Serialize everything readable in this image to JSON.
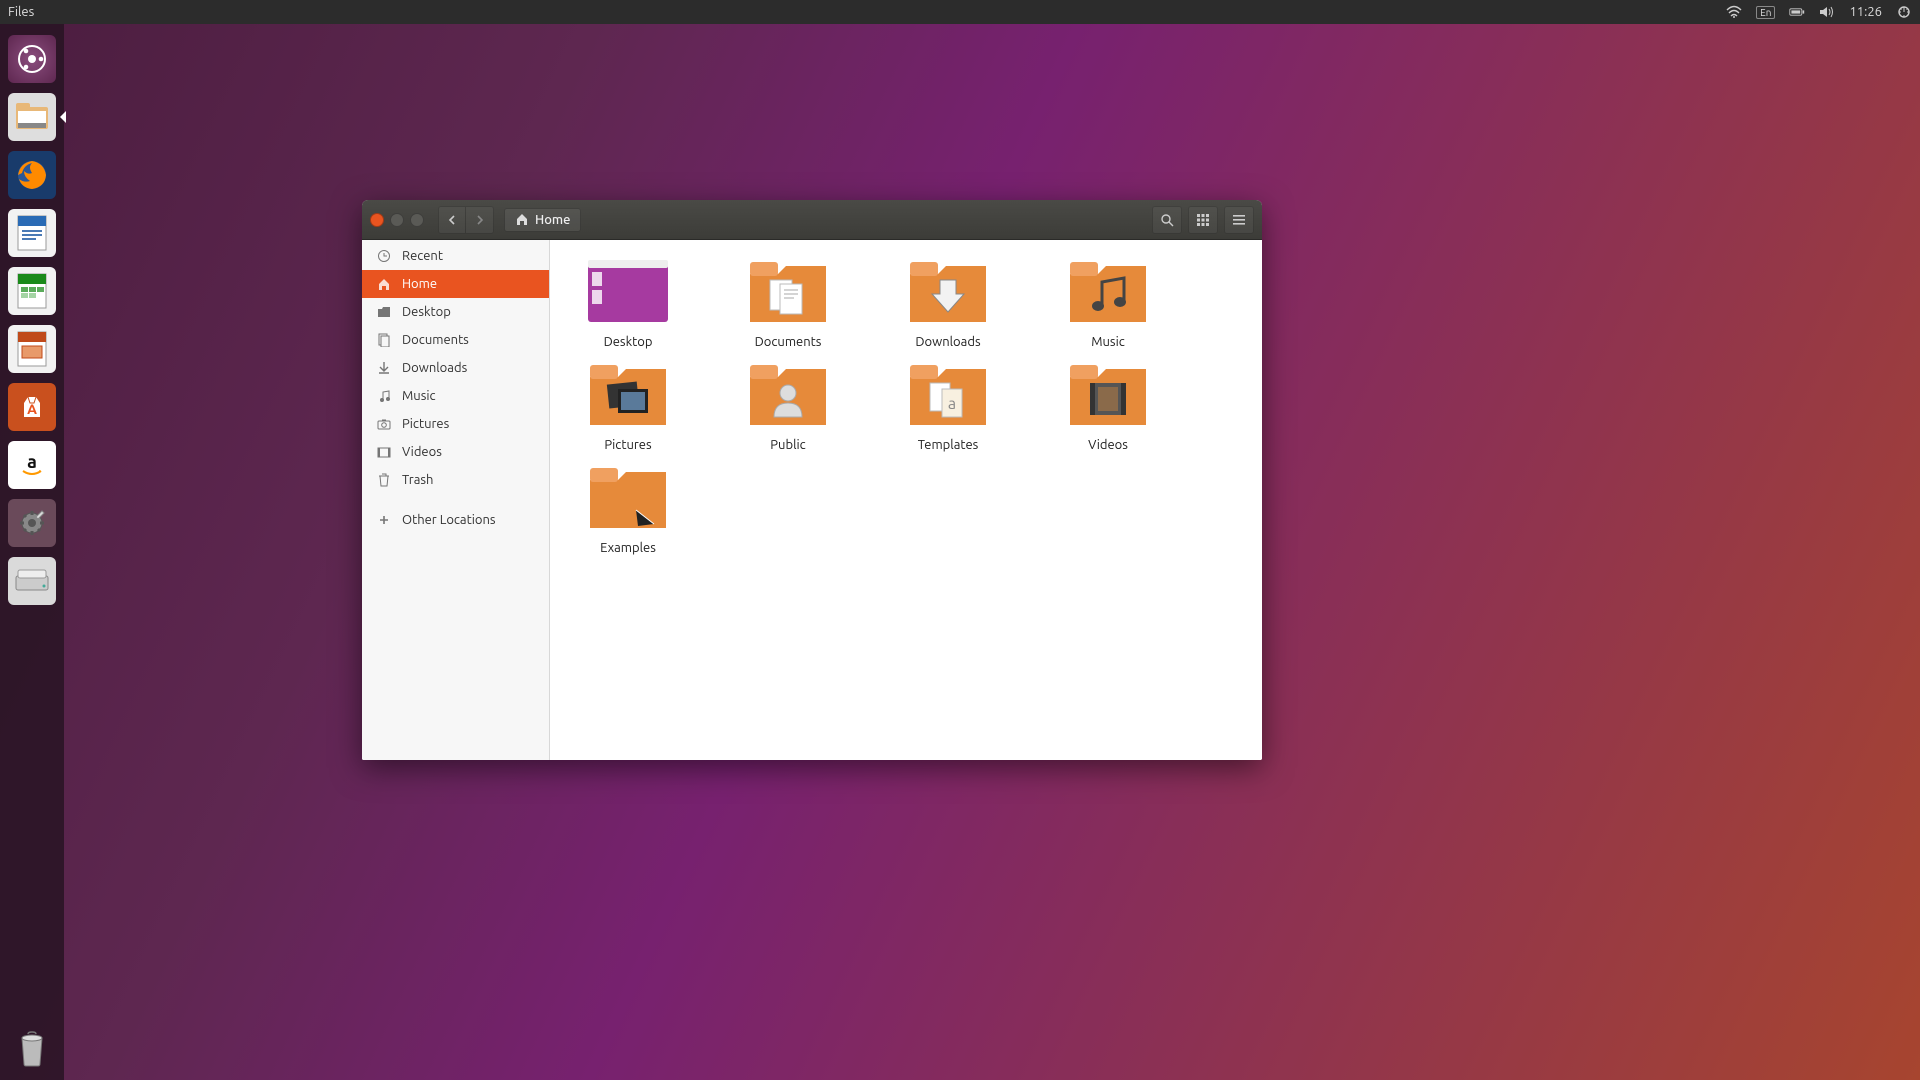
{
  "menubar": {
    "app_name": "Files",
    "lang": "En",
    "clock": "11:26"
  },
  "launcher": {
    "items": [
      {
        "name": "dash",
        "label": "Dash"
      },
      {
        "name": "files",
        "label": "Files",
        "active": true
      },
      {
        "name": "firefox",
        "label": "Firefox"
      },
      {
        "name": "writer",
        "label": "LibreOffice Writer"
      },
      {
        "name": "calc",
        "label": "LibreOffice Calc"
      },
      {
        "name": "impress",
        "label": "LibreOffice Impress"
      },
      {
        "name": "software",
        "label": "Ubuntu Software"
      },
      {
        "name": "amazon",
        "label": "Amazon"
      },
      {
        "name": "settings",
        "label": "System Settings"
      },
      {
        "name": "disk",
        "label": "Disk"
      }
    ],
    "trash": {
      "label": "Trash"
    }
  },
  "filemanager": {
    "path_label": "Home",
    "sidebar": {
      "items": [
        {
          "icon": "clock-icon",
          "label": "Recent"
        },
        {
          "icon": "home-icon",
          "label": "Home",
          "selected": true
        },
        {
          "icon": "folder-icon",
          "label": "Desktop"
        },
        {
          "icon": "documents-icon",
          "label": "Documents"
        },
        {
          "icon": "download-icon",
          "label": "Downloads"
        },
        {
          "icon": "music-icon",
          "label": "Music"
        },
        {
          "icon": "camera-icon",
          "label": "Pictures"
        },
        {
          "icon": "video-icon",
          "label": "Videos"
        },
        {
          "icon": "trash-icon",
          "label": "Trash"
        }
      ],
      "other": {
        "icon": "plus-icon",
        "label": "Other Locations"
      }
    },
    "folders": [
      {
        "name": "Desktop",
        "type": "desktop"
      },
      {
        "name": "Documents",
        "type": "documents"
      },
      {
        "name": "Downloads",
        "type": "downloads"
      },
      {
        "name": "Music",
        "type": "music"
      },
      {
        "name": "Pictures",
        "type": "pictures"
      },
      {
        "name": "Public",
        "type": "public"
      },
      {
        "name": "Templates",
        "type": "templates"
      },
      {
        "name": "Videos",
        "type": "videos"
      },
      {
        "name": "Examples",
        "type": "examples"
      }
    ]
  }
}
